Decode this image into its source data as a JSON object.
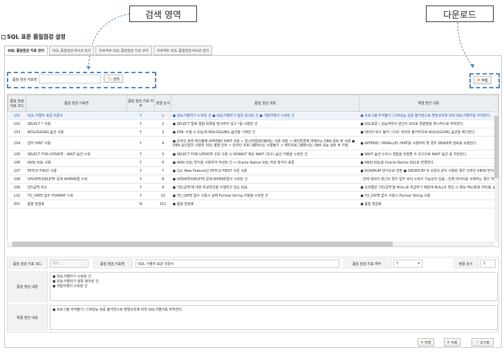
{
  "callouts": {
    "search_area": "검색 영역",
    "download": "다운로드"
  },
  "page_title": "SQL 표준 품질점검 설정",
  "tabs": [
    "SQL 품질점검 지표 관리",
    "SQL 품질점검 RULE 관리",
    "프로젝트 SQL 품질점검 지표 관리",
    "프로젝트 SQL 품질점검 RULE 관리"
  ],
  "search": {
    "label": "품질 점검 지표명",
    "value": "",
    "button": "검색"
  },
  "excel_button": "엑셀",
  "table": {
    "headers": [
      "품질 점검 지표 코드",
      "품질 점검 지표명",
      "품질 점검 지표 여부",
      "정렬 순서",
      "품질 점검 내용",
      "해결 방안 내용"
    ],
    "rows": [
      {
        "code": "101",
        "name": "SQL 식별자 표준 미준수",
        "yn": "Y",
        "order": "1",
        "content": "● SQL식별자가 누락된 건 ● SQL식별자가 잘못 정의된 건 ● 개발자명이 누락된 건",
        "solution": "● 프로그램 추적불가 / CM성능 검증 불가방으로 명명규칙에 따라 SQL식별자를 부여한다.",
        "selected": true
      },
      {
        "code": "102",
        "name": "SELECT * 사용",
        "yn": "Y",
        "order": "2",
        "content": "● SELECT 절에 컬럼 목록을 명시하지 않고 *를 사용한 건",
        "solution": "● SQL표준 / 성능저하의 원인이 되므로 컬럼명을 명시적으로 부여한다."
      },
      {
        "code": "103",
        "name": "NOLOGGING 옵션 사용",
        "yn": "Y",
        "order": "3",
        "content": "● DML 수행 시 SQL에 NOLOGGING 옵션을 기재한 건",
        "solution": "● 데이터 복구 불가 / CDC 처리의 불가하므로 NOLOGGING 옵션을 제거한다."
      },
      {
        "code": "104",
        "name": "금지 HINT 사용",
        "yn": "Y",
        "order": "4",
        "content": "● 온라인 화면 테이블에 APPEND HINT 사용 > 임시작업테이블에는 사용 권장 > 배치환경에 대해서는 DBA 검토 후 사용 ● DBA 승인없이 사용한 SQL 병렬 힌트 > 온라인 프로그램에서는 사용불가 > 배치프로그램에서는 DBA 성능 검토 후 지정",
        "solution": "● APPEND / PARALLEL HINT를 사용하여 할 경우 DBA에게 검토를 요청한다.",
        "tall": true
      },
      {
        "code": "105",
        "name": "SELECT FOR UPDATE - WAIT 옵션 누락",
        "yn": "Y",
        "order": "5",
        "content": "● SELECT FOR UPDATE 구문 사용 시 NOWAIT 혹은 WAIT (초수) 옵션 지정을 누락한 건",
        "solution": "● WAIT 옵션 누락시 경합을 유발할 수 있으므로 WAIT 옵션 를 지정한다."
      },
      {
        "code": "106",
        "name": "ANSI SQL 사용",
        "yn": "Y",
        "order": "6",
        "content": "● ANSI SQL 방식을 사용하여 작성된 건 > Oracle Native SQL 작성 방식이 표준",
        "solution": "● ANSI SQL을 Oracle Native SQL로 변경한다."
      },
      {
        "code": "107",
        "name": "FETCH FIRST 사용",
        "yn": "Y",
        "order": "7",
        "content": "● 12c New Feature인 FETCH FIRST 구문 사용",
        "solution": "● ROWNUM 방식으로 전환 ● ORDER BY N 구문과 같이 사용된 경우 인라인 VIEW 방식으..."
      },
      {
        "code": "108",
        "name": "UPDATE/DELETE 문에 WHERE절 누락",
        "yn": "Y",
        "order": "8",
        "content": "● UPDATE/DELETE 문에 WHERE절이 누락된 건",
        "solution": "- 전체 데이터 갱신의 경우 업무 로직 누락이 가능성이 있음 - 전체 데이터를 삭제하는 경우 TRU..."
      },
      {
        "code": "109",
        "name": "(반)공백 비교",
        "yn": "Y",
        "order": "9",
        "content": "● '(반)공백'에 대한 비교연산을 수행하고 있는 SQL",
        "solution": "● 오라클은 '(반)공백'을 NULL로 취급하기 때문에 NULL과 연산 시 항상 FALSE로 처리됨. ● IS N..."
      },
      {
        "code": "110",
        "name": "TO_DATE 함수 FORMAT 누락",
        "yn": "Y",
        "order": "10",
        "content": "● TO_DATE 함수 사용시 날짜 Format String 지정을 누락한 건",
        "solution": "● TO_DATE 함수 사용시 Format String 사용"
      },
      {
        "code": "001",
        "name": "품질 점검표",
        "yn": "N",
        "order": "101",
        "content": "● 품질 점검표",
        "solution": "● 품질 점검표"
      }
    ]
  },
  "detail": {
    "code_label": "품질 점검 지표 코드",
    "code_value": "101",
    "name_label": "품질 점검 지표명",
    "name_value": "SQL 식별자 표준 미준수",
    "yn_label": "품질 점검 지표 여부",
    "yn_value": "Y",
    "order_label": "정렬 순서",
    "order_value": "1",
    "content_label": "품질 점검 내용",
    "content_lines": [
      "● SQL식별자가 누락된 건",
      "● SQL식별자가 잘못 정의된 건",
      "● 개발자명이 누락된 건"
    ],
    "solution_label": "해결 방안 내용",
    "solution_value": "● 프로그램 추적불가 / CM성능 검증 불가방으로 명명규칙에 따라 SQL식별자를 부여한다."
  },
  "buttons": {
    "save": "저장",
    "delete": "삭제",
    "reset": "초기화"
  },
  "colors": {
    "accent": "#4a86c8",
    "selected_text": "#2a5caa",
    "header_bg": "#e9eef3"
  }
}
